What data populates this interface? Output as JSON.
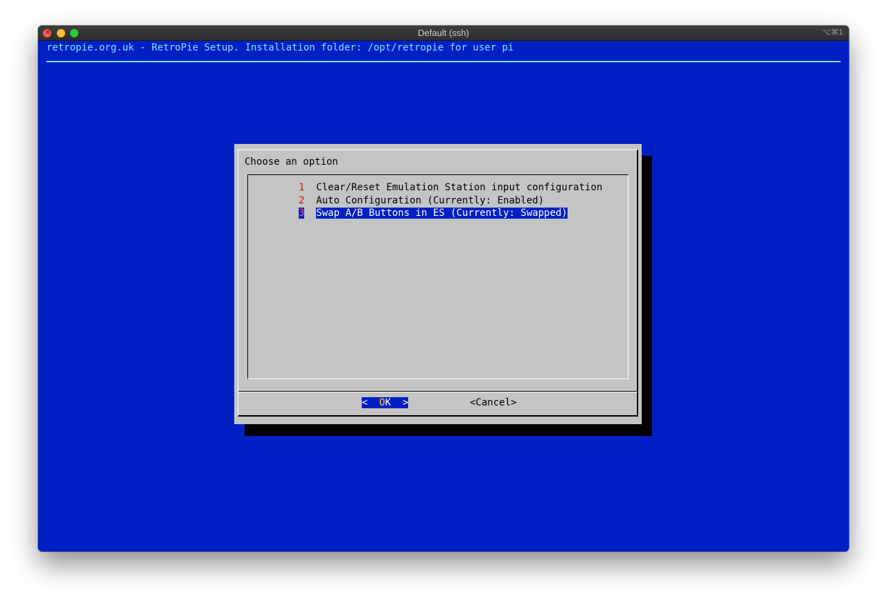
{
  "window": {
    "title": "Default (ssh)",
    "shortcut": "⌥⌘1"
  },
  "terminal": {
    "header": "retropie.org.uk - RetroPie Setup. Installation folder: /opt/retropie for user pi"
  },
  "dialog": {
    "prompt": "Choose an option",
    "items": [
      {
        "tag": "1",
        "label": "Clear/Reset Emulation Station input configuration",
        "selected": false
      },
      {
        "tag": "2",
        "label": "Auto Configuration (Currently: Enabled)",
        "selected": false
      },
      {
        "tag": "3",
        "label": "Swap A/B Buttons in ES (Currently: Swapped)",
        "selected": true
      }
    ],
    "ok_button": {
      "left": "<  ",
      "hot": "O",
      "rest": "K  >"
    },
    "cancel_button": "<Cancel>"
  },
  "colors": {
    "terminal_bg": "#0020c4",
    "header_text": "#7fe3ff",
    "dialog_bg": "#c4c4c4",
    "tag_red": "#c41818",
    "hotkey_yellow": "#ffd633"
  }
}
